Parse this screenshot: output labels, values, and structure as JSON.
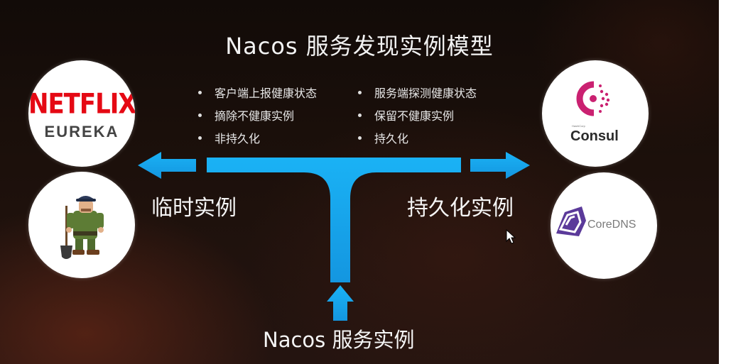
{
  "title": "Nacos 服务发现实例模型",
  "left_column": {
    "items": [
      "客户端上报健康状态",
      "摘除不健康实例",
      "非持久化"
    ]
  },
  "right_column": {
    "items": [
      "服务端探测健康状态",
      "保留不健康实例",
      "持久化"
    ]
  },
  "labels": {
    "temporary": "临时实例",
    "persistent": "持久化实例",
    "bottom": "Nacos 服务实例"
  },
  "logos": {
    "eureka": {
      "top": "NETFLIX",
      "bottom": "EUREKA"
    },
    "consul": {
      "small": "HashiCorp",
      "name": "Consul"
    },
    "coredns": {
      "name": "CoreDNS"
    }
  },
  "colors": {
    "arrow": "#19a6ef",
    "netflix_red": "#e50914",
    "consul_pink": "#ca2171",
    "coredns_purple": "#5b3a9a"
  }
}
